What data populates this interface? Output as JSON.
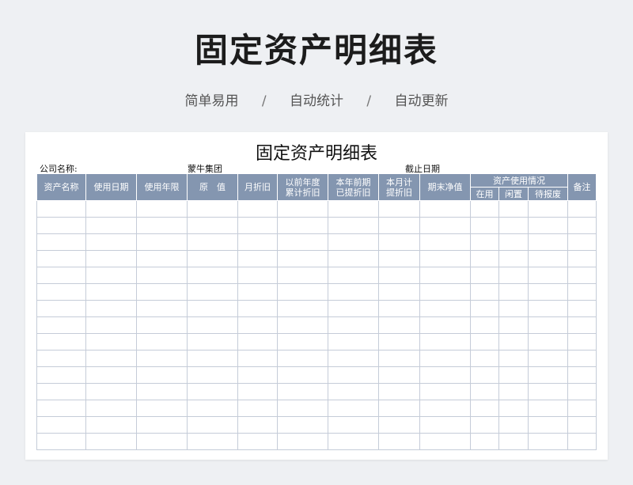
{
  "hero_title": "固定资产明细表",
  "features": [
    "简单易用",
    "自动统计",
    "自动更新"
  ],
  "separator": "/",
  "sheet": {
    "title": "固定资产明细表",
    "company_label": "公司名称:",
    "company_value": "蒙牛集团",
    "cutoff_label": "截止日期"
  },
  "table": {
    "headers": {
      "asset_name": "资产名称",
      "use_date": "使用日期",
      "use_years": "使用年限",
      "original_value": "原　值",
      "monthly_depr": "月折旧",
      "prior_year_depr_line1": "以前年度",
      "prior_year_depr_line2": "累计折旧",
      "prior_period_depr_line1": "本年前期",
      "prior_period_depr_line2": "已提折旧",
      "month_depr_line1": "本月计",
      "month_depr_line2": "提折旧",
      "net_value": "期末净值",
      "usage_group": "资产使用情况",
      "in_use": "在用",
      "idle": "闲置",
      "to_scrap": "待报废",
      "remarks": "备注"
    },
    "empty_rows": 15
  }
}
